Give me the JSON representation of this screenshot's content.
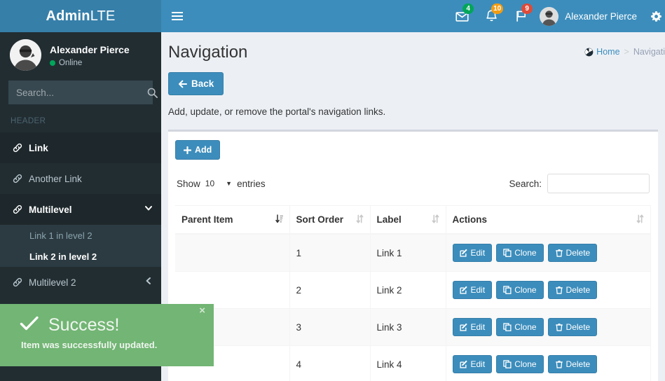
{
  "brand": {
    "bold": "Admin",
    "light": "LTE"
  },
  "navbar": {
    "hamburger_icon": "bars-icon",
    "messages": {
      "icon": "envelope-icon",
      "count": "4"
    },
    "notifications": {
      "icon": "bell-icon",
      "count": "10"
    },
    "tasks": {
      "icon": "flag-icon",
      "count": "9"
    },
    "user_name": "Alexander Pierce",
    "user_avatar": "avatar",
    "settings_icon": "gear-icon"
  },
  "sidebar": {
    "user": {
      "name": "Alexander Pierce",
      "status": "Online",
      "avatar": "avatar"
    },
    "search": {
      "placeholder": "Search...",
      "value": "",
      "icon": "search-icon"
    },
    "header_label": "HEADER",
    "items": [
      {
        "label": "Link",
        "icon": "link-icon"
      },
      {
        "label": "Another Link",
        "icon": "link-icon"
      },
      {
        "label": "Multilevel",
        "icon": "link-icon",
        "caret": "chevron-down-icon"
      },
      {
        "label": "Multilevel 2",
        "icon": "link-icon",
        "caret": "chevron-left-icon"
      }
    ],
    "submenu": [
      {
        "label": "Link 1 in level 2"
      },
      {
        "label": "Link 2 in level 2"
      }
    ]
  },
  "page": {
    "title": "Navigation",
    "breadcrumb": {
      "home": "Home",
      "separator": ">",
      "current": "Navigati",
      "home_icon": "dashboard-icon"
    },
    "back_button": {
      "label": "Back",
      "icon": "arrow-left-icon"
    },
    "description": "Add, update, or remove the portal's navigation links."
  },
  "table_panel": {
    "add_button": {
      "label": "Add",
      "icon": "plus-icon"
    },
    "length": {
      "show_label": "Show",
      "value": "10",
      "entries_label": "entries",
      "arrow": "caret-down-icon"
    },
    "filter": {
      "label": "Search:",
      "value": "",
      "placeholder": ""
    },
    "columns": [
      {
        "label": "Parent Item",
        "sort": "sort-amount-asc-icon",
        "sorted": true
      },
      {
        "label": "Sort Order",
        "sort": "sort-icon",
        "sorted": false
      },
      {
        "label": "Label",
        "sort": "sort-icon",
        "sorted": false
      },
      {
        "label": "Actions",
        "sort": "sort-icon",
        "sorted": false
      }
    ],
    "rows": [
      {
        "parent": "",
        "sort_order": "1",
        "label": "Link 1"
      },
      {
        "parent": "",
        "sort_order": "2",
        "label": "Link 2"
      },
      {
        "parent": "",
        "sort_order": "3",
        "label": "Link 3"
      },
      {
        "parent": "",
        "sort_order": "4",
        "label": "Link 4"
      }
    ],
    "row_actions": {
      "edit": {
        "label": "Edit",
        "icon": "pencil-square-icon"
      },
      "clone": {
        "label": "Clone",
        "icon": "copy-icon"
      },
      "delete": {
        "label": "Delete",
        "icon": "trash-icon"
      }
    }
  },
  "toast": {
    "title": "Success!",
    "message": "Item was successfully updated.",
    "close_label": "×",
    "check_icon": "check-icon"
  },
  "colors": {
    "navbar_blue": "#3c8dbc",
    "logo_blue": "#367fa9",
    "sidebar_dark": "#222d32",
    "content_bg": "#ecf0f5",
    "success_dark": "#44854a",
    "success_light": "#72b574",
    "badge_green": "#00a65a",
    "badge_yellow": "#f39c12",
    "badge_red": "#dd4b39"
  }
}
